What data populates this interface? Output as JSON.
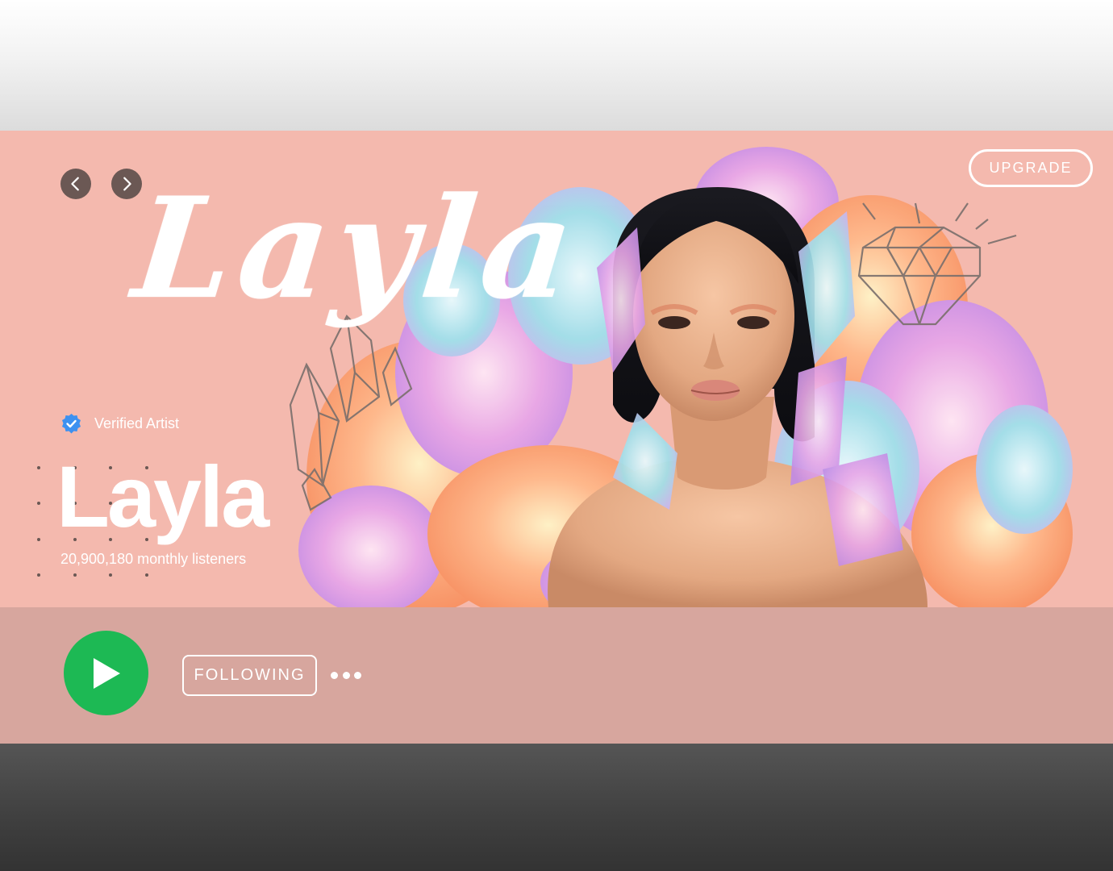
{
  "topbar": {
    "upgrade_label": "UPGRADE"
  },
  "nav": {
    "back_icon": "chevron-left-icon",
    "forward_icon": "chevron-right-icon"
  },
  "hero": {
    "script_title": "Layla",
    "verified_label": "Verified Artist",
    "artist_name": "Layla",
    "monthly_listeners": "20,900,180 monthly listeners"
  },
  "actions": {
    "play_icon": "play-icon",
    "following_label": "FOLLOWING",
    "more_icon": "more-options-icon"
  },
  "colors": {
    "hero_background": "#f4b9ae",
    "action_bar": "#d7a69e",
    "play_green": "#1db954",
    "verified_blue": "#3d91f0",
    "nav_button": "#6b5854"
  }
}
